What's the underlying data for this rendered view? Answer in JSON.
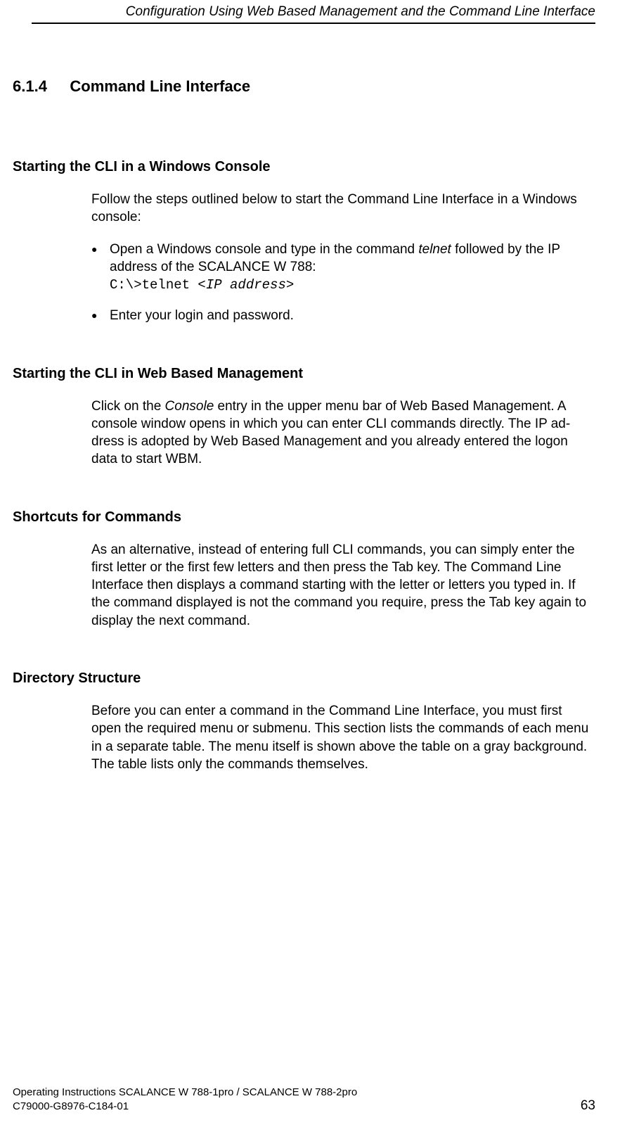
{
  "header": {
    "running_title": "Configuration Using Web Based Management and the Command Line Interface"
  },
  "section": {
    "number": "6.1.4",
    "title": "Command Line Interface"
  },
  "s1": {
    "heading": "Starting the CLI in a Windows Console",
    "intro": "Follow the steps outlined below to start the Command Line Interface in a Windows console:",
    "b1_pre": "Open a Windows console and type in the command ",
    "b1_telnet": "telnet",
    "b1_post": " followed by the IP address of the SCALANCE W 788:",
    "b1_code_pre": "C:\\>telnet ",
    "b1_code_arg": "<IP address>",
    "b2": "Enter your login and password."
  },
  "s2": {
    "heading": "Starting the CLI in Web Based Management",
    "p_pre": "Click on the ",
    "p_console": "Console",
    "p_post": " entry in the upper menu bar of Web Based Management. A console window opens in which you can enter CLI commands directly. The IP ad­dress is adopted by Web Based Management and you already entered the logon data to start WBM."
  },
  "s3": {
    "heading": "Shortcuts for Commands",
    "p": "As an alternative, instead of entering full CLI commands, you can simply enter the first letter or the first few letters and then press the Tab key. The Command Line Interface then displays a command starting with the letter or letters you typed in. If the command displayed is not the command you require, press the Tab key again to display the next command."
  },
  "s4": {
    "heading": "Directory Structure",
    "p": "Before you can enter a command in the Command Line Interface, you must first open the required menu or submenu. This section lists the commands of each menu in a separate table. The menu itself is shown above the table on a gray background. The table lists only the commands themselves."
  },
  "footer": {
    "line1": "Operating Instructions SCALANCE W 788-1pro / SCALANCE W 788-2pro",
    "line2": "C79000-G8976-C184-01",
    "page": "63"
  }
}
